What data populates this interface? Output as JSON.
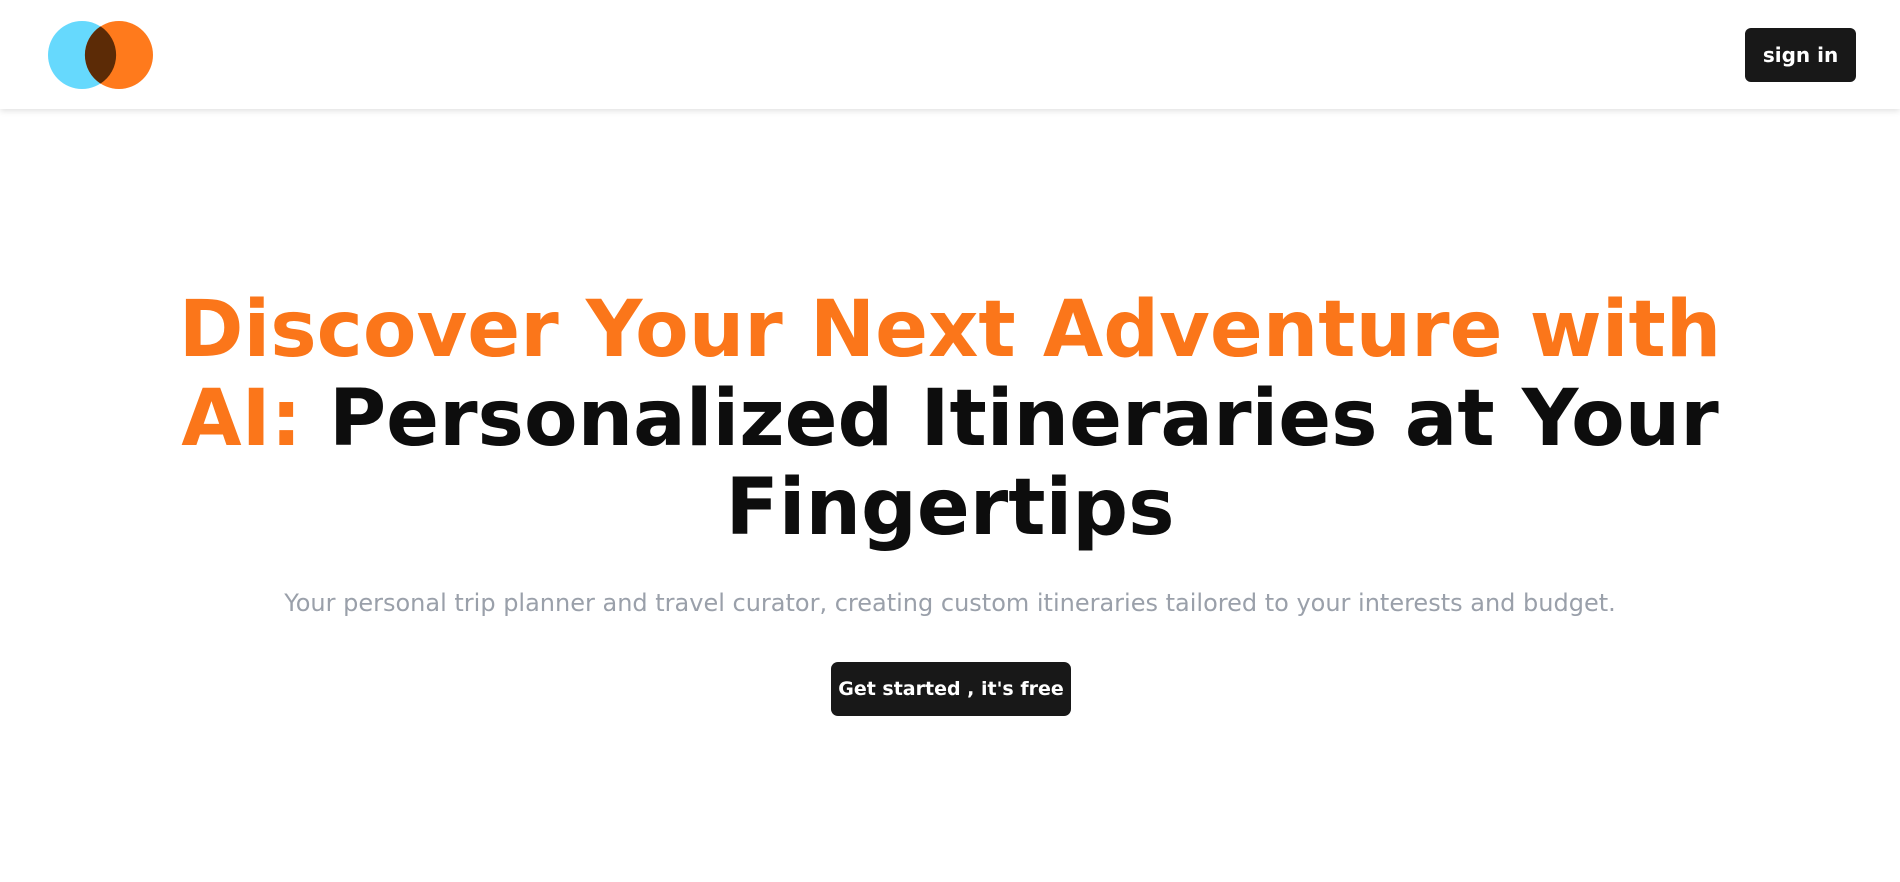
{
  "header": {
    "logo_icon": "overlapping-circles-logo",
    "signin_label": "sign in"
  },
  "hero": {
    "headline_accent": "Discover Your Next Adventure with AI:",
    "headline_rest": "Personalized Itineraries at Your Fingertips",
    "subtitle": "Your personal trip planner and travel curator, creating custom itineraries tailored to your interests and budget.",
    "cta_label": "Get started , it's free"
  },
  "colors": {
    "accent": "#fb761a",
    "logo_blue": "#66d9fd",
    "logo_orange": "#ff7a1c",
    "logo_overlap": "#5c2b06",
    "button_bg": "#181818",
    "subtitle": "#9aa0aa"
  }
}
